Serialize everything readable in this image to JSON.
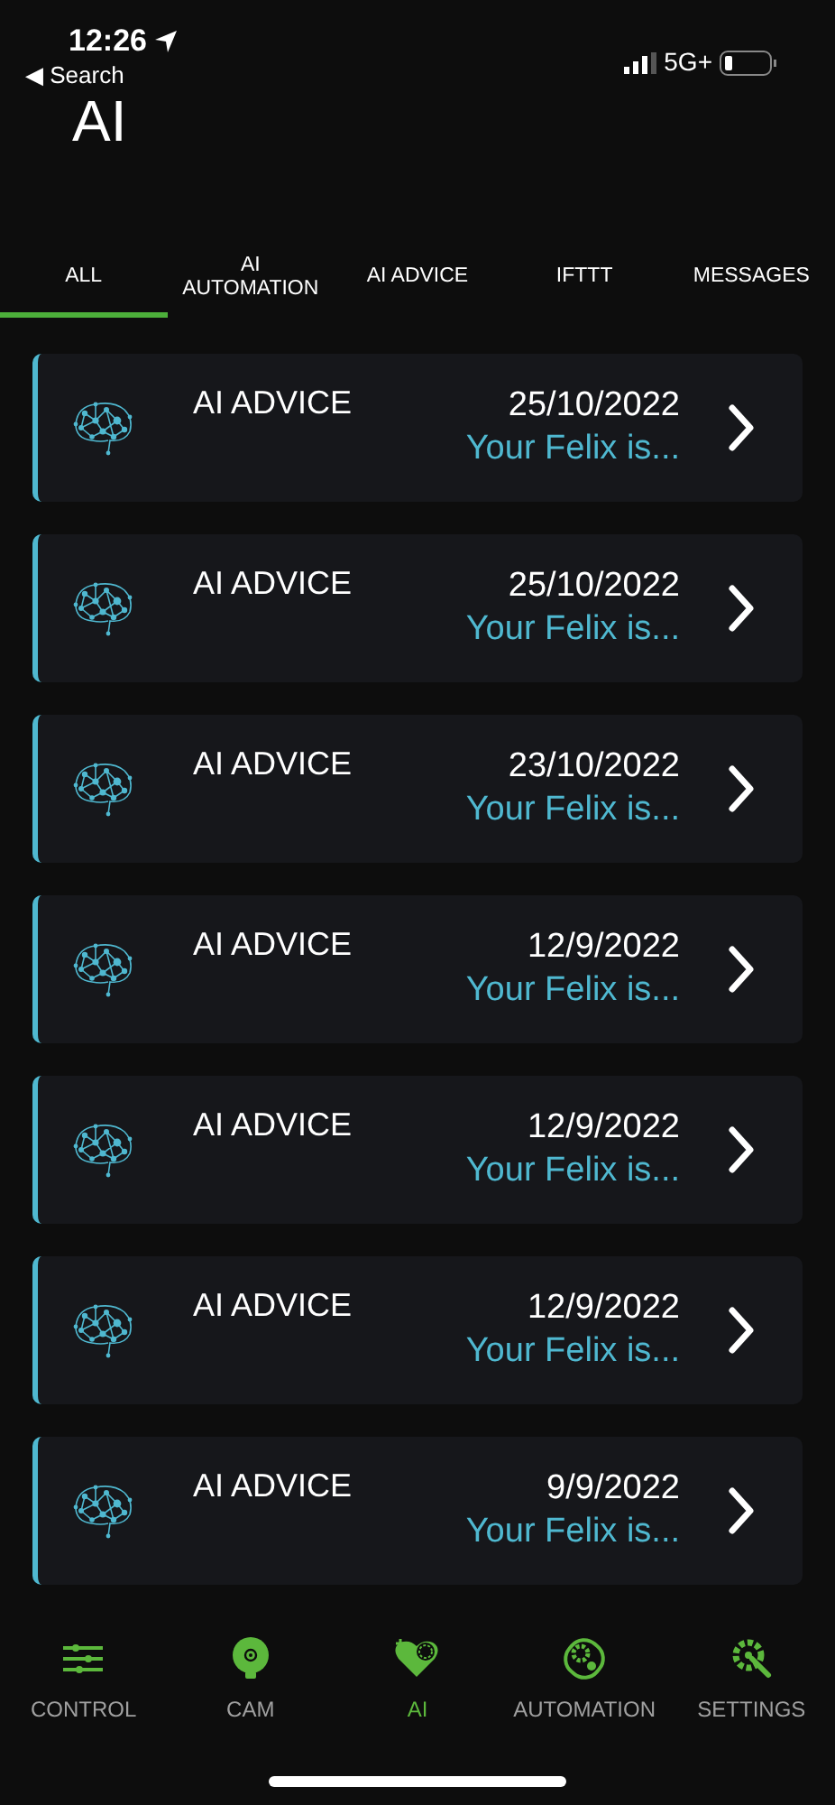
{
  "status_bar": {
    "time": "12:26",
    "network": "5G+"
  },
  "back_link": {
    "label": "◀ Search"
  },
  "title": "AI",
  "tabs": [
    {
      "label": "ALL",
      "selected": true
    },
    {
      "label": "AI AUTOMATION",
      "selected": false
    },
    {
      "label": "AI ADVICE",
      "selected": false
    },
    {
      "label": "IFTTT",
      "selected": false
    },
    {
      "label": "MESSAGES",
      "selected": false
    }
  ],
  "items": [
    {
      "title": "AI ADVICE",
      "date": "25/10/2022",
      "preview": "Your Felix is..."
    },
    {
      "title": "AI ADVICE",
      "date": "25/10/2022",
      "preview": "Your Felix is..."
    },
    {
      "title": "AI ADVICE",
      "date": "23/10/2022",
      "preview": "Your Felix is..."
    },
    {
      "title": "AI ADVICE",
      "date": "12/9/2022",
      "preview": "Your Felix is..."
    },
    {
      "title": "AI ADVICE",
      "date": "12/9/2022",
      "preview": "Your Felix is..."
    },
    {
      "title": "AI ADVICE",
      "date": "12/9/2022",
      "preview": "Your Felix is..."
    },
    {
      "title": "AI ADVICE",
      "date": "9/9/2022",
      "preview": "Your Felix is..."
    }
  ],
  "bottom_nav": [
    {
      "label": "CONTROL",
      "kind": "control",
      "selected": false
    },
    {
      "label": "CAM",
      "kind": "cam",
      "selected": false
    },
    {
      "label": "AI",
      "kind": "ai",
      "selected": true
    },
    {
      "label": "AUTOMATION",
      "kind": "automation",
      "selected": false
    },
    {
      "label": "SETTINGS",
      "kind": "settings",
      "selected": false
    }
  ]
}
